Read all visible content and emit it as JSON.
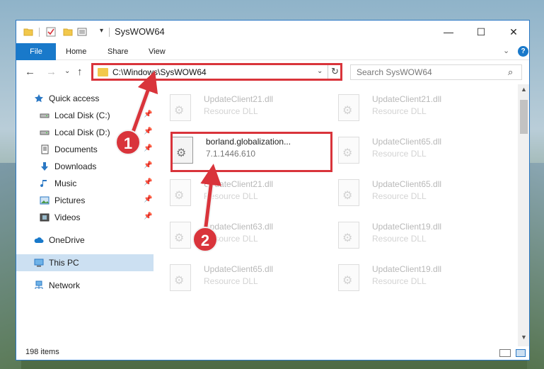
{
  "window": {
    "title": "SysWOW64",
    "controls": {
      "minimize": "—",
      "maximize": "☐",
      "close": "✕"
    }
  },
  "ribbon": {
    "tabs": [
      "File",
      "Home",
      "Share",
      "View"
    ],
    "help": "?"
  },
  "navigation": {
    "address": "C:\\Windows\\SysWOW64",
    "search_placeholder": "Search SysWOW64"
  },
  "sidebar": {
    "items": [
      {
        "label": "Quick access",
        "icon": "star-icon"
      },
      {
        "label": "Local Disk (C:)",
        "icon": "drive-icon",
        "pinned": true
      },
      {
        "label": "Local Disk (D:)",
        "icon": "drive-icon",
        "pinned": true
      },
      {
        "label": "Documents",
        "icon": "documents-icon",
        "pinned": true
      },
      {
        "label": "Downloads",
        "icon": "download-icon",
        "pinned": true
      },
      {
        "label": "Music",
        "icon": "music-icon",
        "pinned": true
      },
      {
        "label": "Pictures",
        "icon": "pictures-icon",
        "pinned": true
      },
      {
        "label": "Videos",
        "icon": "videos-icon",
        "pinned": true
      },
      {
        "label": "OneDrive",
        "icon": "cloud-icon"
      },
      {
        "label": "This PC",
        "icon": "computer-icon",
        "selected": true
      },
      {
        "label": "Network",
        "icon": "network-icon"
      }
    ]
  },
  "files": {
    "left": [
      {
        "name": "UpdateClient21.dll",
        "desc": "Resource DLL"
      },
      {
        "name": "borland.globalization...",
        "desc": "7.1.1446.610",
        "featured": true
      },
      {
        "name": "UpdateClient21.dll",
        "desc": "Resource DLL"
      },
      {
        "name": "UpdateClient63.dll",
        "desc": "Resource DLL"
      },
      {
        "name": "UpdateClient65.dll",
        "desc": "Resource DLL"
      }
    ],
    "right": [
      {
        "name": "UpdateClient21.dll",
        "desc": "Resource DLL"
      },
      {
        "name": "UpdateClient65.dll",
        "desc": "Resource DLL"
      },
      {
        "name": "UpdateClient65.dll",
        "desc": "Resource DLL"
      },
      {
        "name": "UpdateClient19.dll",
        "desc": "Resource DLL"
      },
      {
        "name": "UpdateClient19.dll",
        "desc": "Resource DLL"
      }
    ]
  },
  "status": {
    "item_count": "198 items"
  },
  "annotations": {
    "step1": "1",
    "step2": "2"
  },
  "colors": {
    "accent": "#1979ca",
    "highlight": "#d9343b",
    "selection": "#cce0f2"
  }
}
